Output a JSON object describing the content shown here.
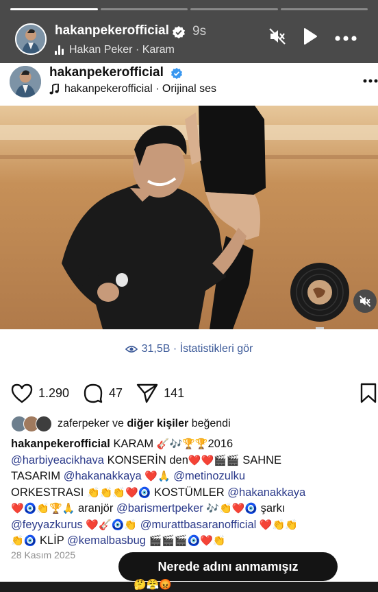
{
  "story": {
    "progress": [
      true,
      false,
      false,
      false
    ],
    "username": "hakanpekerofficial",
    "time_ago": "9s",
    "music": "Hakan Peker · Karam",
    "icons": {
      "mute": "speaker-muted-icon",
      "play": "play-icon",
      "more": "more-icon"
    }
  },
  "post": {
    "username": "hakanpekerofficial",
    "audio": "hakanpekerofficial · Orijinal ses",
    "views_label": "31,5B · İstatistikleri gör",
    "likes": "1.290",
    "comments": "47",
    "shares": "141",
    "liked_by_user": "zaferpeker",
    "liked_by_joiner": "ve",
    "liked_by_others": "diğer kişiler",
    "liked_by_suffix": "beğendi",
    "caption": {
      "l1_user": "hakanpekerofficial",
      "l1_text": "KARAM",
      "l1_emoji": "🎸🎶🏆🏆",
      "l1_year": "2016",
      "l2_mention": "@harbiyeacikhava",
      "l2_text": "KONSERİN den",
      "l2_emoji": "❤️❤️🎬🎬",
      "l2_text2": "SAHNE",
      "l3_text": "TASARIM",
      "l3_mention": "@hakanakkaya",
      "l3_emoji": "❤️🙏",
      "l3_mention2": "@metinozulku",
      "l4_text": "ORKESTRASI",
      "l4_emoji": "👏👏👏❤️🧿",
      "l4_text2": "KOSTÜMLER",
      "l4_mention": "@hakanakkaya",
      "l5_emoji": "❤️🧿👏🏆🙏",
      "l5_text": "aranjör",
      "l5_mention": "@barismertpeker",
      "l5_emoji2": "🎶👏❤️🧿",
      "l5_text2": "şarkı",
      "l6_mention": "@feyyazkurus",
      "l6_emoji": "❤️🎸🧿👏",
      "l6_mention2": "@murattbasaranofficial",
      "l6_emoji2": "❤️👏👏",
      "l7_emoji": "👏🧿",
      "l7_text": "KLİP",
      "l7_mention": "@kemalbasbug",
      "l7_emoji2": "🎬🎬🎬🧿❤️👏"
    },
    "date": "28 Kasım 2025"
  },
  "sticker": {
    "text": "Nerede adını anmamışız",
    "emojis": "🤔😤😡"
  }
}
